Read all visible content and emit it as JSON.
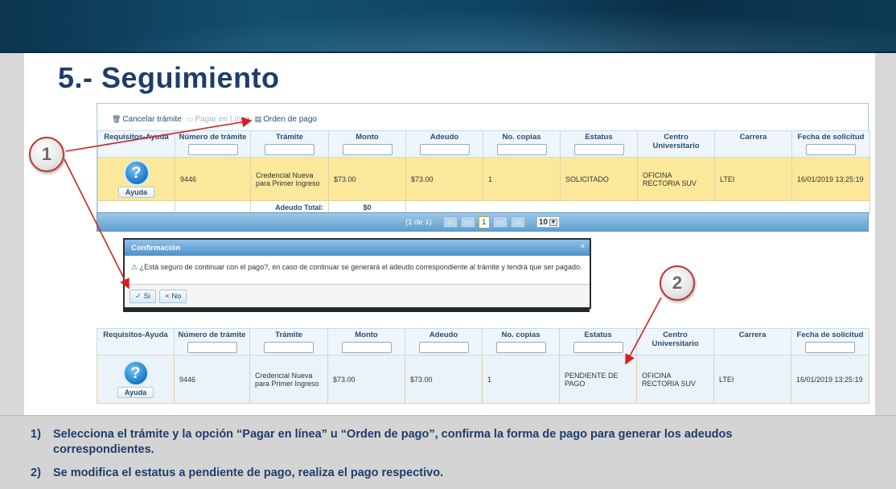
{
  "title": "5.- Seguimiento",
  "toolbar": {
    "cancel": "Cancelar trámite",
    "pay_online": "Pagar en Línea",
    "payment_order": "Orden de pago"
  },
  "columns": [
    "Requisitos-Ayuda",
    "Número de trámite",
    "Trámite",
    "Monto",
    "Adeudo",
    "No. copias",
    "Estatus",
    "Centro Universitario",
    "Carrera",
    "Fecha de solicitud"
  ],
  "grid1": {
    "row": {
      "help_label": "Ayuda",
      "numero": "9446",
      "tramite": "Credencial Nueva para Primer Ingreso",
      "monto": "$73.00",
      "adeudo": "$73.00",
      "copias": "1",
      "estatus": "SOLICITADO",
      "centro": "OFICINA RECTORIA SUV",
      "carrera": "LTEI",
      "fecha": "16/01/2019 13:25:19"
    },
    "total_label": "Adeudo Total:",
    "total_value": "$0",
    "pager": {
      "info": "(1 de 1)",
      "first": "|<",
      "prev": "<<",
      "current": "1",
      "next": ">>",
      "last": ">|",
      "page_size": "10"
    }
  },
  "dialog": {
    "title": "Confirmación",
    "close": "×",
    "message": "¿Está seguro de continuar con el pago?, en caso de continuar se generará el adeudo correspondiente al trámite y tendrá que ser pagado.",
    "yes": "Si",
    "no": "No"
  },
  "grid2": {
    "row": {
      "help_label": "Ayuda",
      "numero": "9446",
      "tramite": "Credencial Nueva para Primer Ingreso",
      "monto": "$73.00",
      "adeudo": "$73.00",
      "copias": "1",
      "estatus": "PENDIENTE DE PAGO",
      "centro": "OFICINA RECTORIA SUV",
      "carrera": "LTEI",
      "fecha": "16/01/2019 13:25:19"
    }
  },
  "callouts": [
    "1",
    "2"
  ],
  "notes": [
    {
      "num": "1)",
      "text": "Selecciona el trámite y la opción “Pagar en línea” u “Orden de pago”, confirma la forma de pago para generar los adeudos correspondientes."
    },
    {
      "num": "2)",
      "text": "Se modifica el estatus a pendiente de pago, realiza el pago respectivo."
    }
  ],
  "colors": {
    "title": "#1f3d6a",
    "selected_row": "#fbe89a",
    "arrow": "#d42020",
    "banner": "#0e4463"
  }
}
